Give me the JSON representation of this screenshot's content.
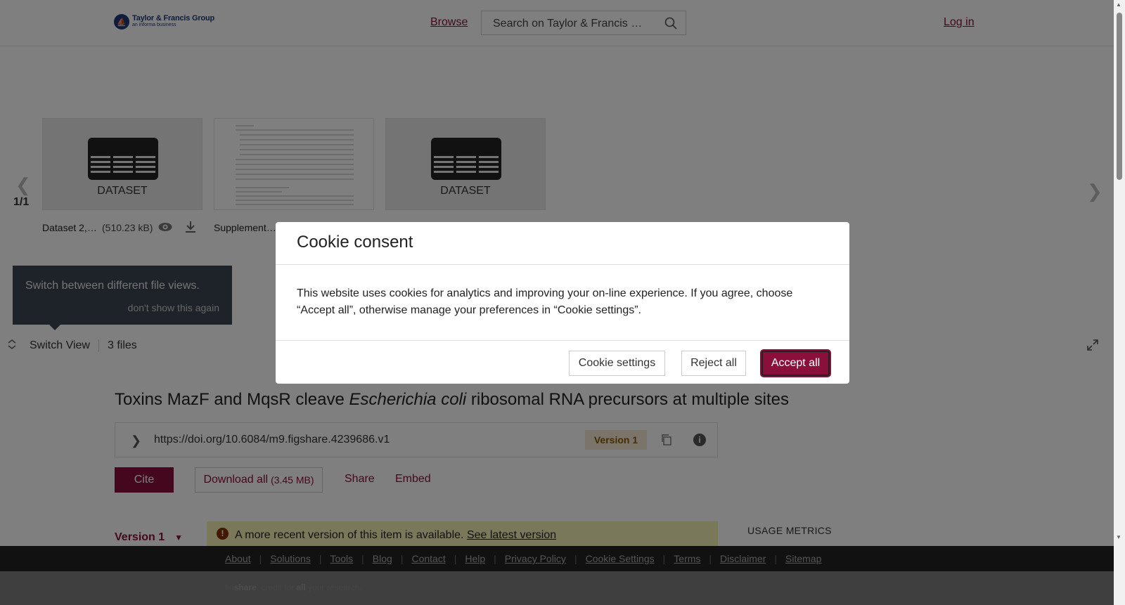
{
  "header": {
    "logo_text": "Taylor & Francis Group",
    "logo_subtext": "an informa business",
    "browse": "Browse",
    "search_placeholder": "Search on Taylor & Francis …",
    "login": "Log in"
  },
  "viewer": {
    "pager": "1/1",
    "thumb1_label": "DATASET",
    "thumb3_label": "DATASET",
    "file1_name": "Dataset 2,…",
    "file1_size": "(510.23 kB)",
    "file2_name": "Supplement…"
  },
  "tooltip": {
    "text": "Switch between different file views.",
    "dismiss": "don't show this again"
  },
  "switchbar": {
    "label": "Switch View",
    "files": "3 files"
  },
  "article": {
    "title_pre": "Toxins MazF and MqsR cleave ",
    "title_italic": "Escherichia coli",
    "title_post": " ribosomal RNA precursors at multiple sites",
    "doi": "https://doi.org/10.6084/m9.figshare.4239686.v1",
    "version_badge": "Version 1",
    "cite": "Cite",
    "download_all": "Download all",
    "download_size": "(3.45 MB)",
    "share": "Share",
    "embed": "Embed",
    "version_dropdown": "Version 1",
    "notice_text": "A more recent version of this item is available.",
    "notice_link": "See latest version",
    "usage_metrics": "USAGE METRICS"
  },
  "modal": {
    "title": "Cookie consent",
    "body": "This website uses cookies for analytics and improving your on-line experience. If you agree, choose “Accept all”, otherwise manage your preferences in “Cookie settings”.",
    "settings": "Cookie settings",
    "reject": "Reject all",
    "accept": "Accept all"
  },
  "footer": {
    "links": [
      "About",
      "Solutions",
      "Tools",
      "Blog",
      "Contact",
      "Help",
      "Privacy Policy",
      "Cookie Settings",
      "Terms",
      "Disclaimer",
      "Sitemap"
    ],
    "credit_fig": "fig",
    "credit_share": "share",
    "credit_mid": ". credit for ",
    "credit_all": "all",
    "credit_end": " your research."
  },
  "colors": {
    "brand": "#8a0f3a",
    "badge_bg": "#f5e8d6",
    "notice_bg": "#f4f1b4"
  }
}
